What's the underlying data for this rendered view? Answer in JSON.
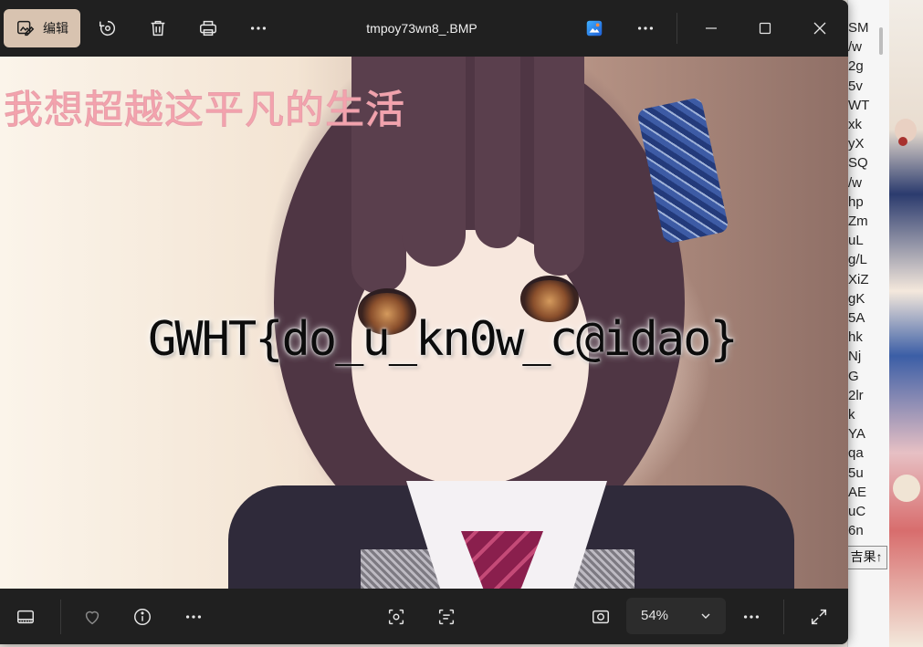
{
  "window": {
    "title": "tmpoy73wn8_.BMP",
    "edit_label": "编辑"
  },
  "image": {
    "chinese_caption": "我想超越这平凡的生活",
    "flag_text": "GWHT{do_u_kn0w_c@idao}"
  },
  "toolbar_icons": [
    "edit-icon",
    "rotate-icon",
    "delete-icon",
    "print-icon",
    "more-icon",
    "adjust-app-icon",
    "more-icon"
  ],
  "caption_buttons": [
    "minimize",
    "maximize",
    "close"
  ],
  "bottom_bar": {
    "zoom_value": "54%",
    "icons": [
      "filmstrip-icon",
      "favorite-icon",
      "info-icon",
      "more-icon",
      "visual-search-icon",
      "ocr-text-icon",
      "fit-icon",
      "more-icon",
      "fullscreen-icon"
    ]
  },
  "background_window": {
    "lines": [
      "SM",
      "/w",
      "2g",
      "5v",
      "WT",
      "xk",
      "yX",
      "SQ",
      "/w",
      "hp",
      "Zm",
      "uL",
      "g/L",
      "XiZ",
      "gK",
      "5A",
      "hk",
      "Nj",
      "G",
      "2lr",
      "k",
      "YA",
      "qa",
      "5u",
      "AE",
      "uC",
      "6n"
    ],
    "result_button": "吉果"
  },
  "colors": {
    "edit_button_bg": "#d8c3b0",
    "chrome_bg": "#202020",
    "caption_text": "#f4a2ad"
  }
}
